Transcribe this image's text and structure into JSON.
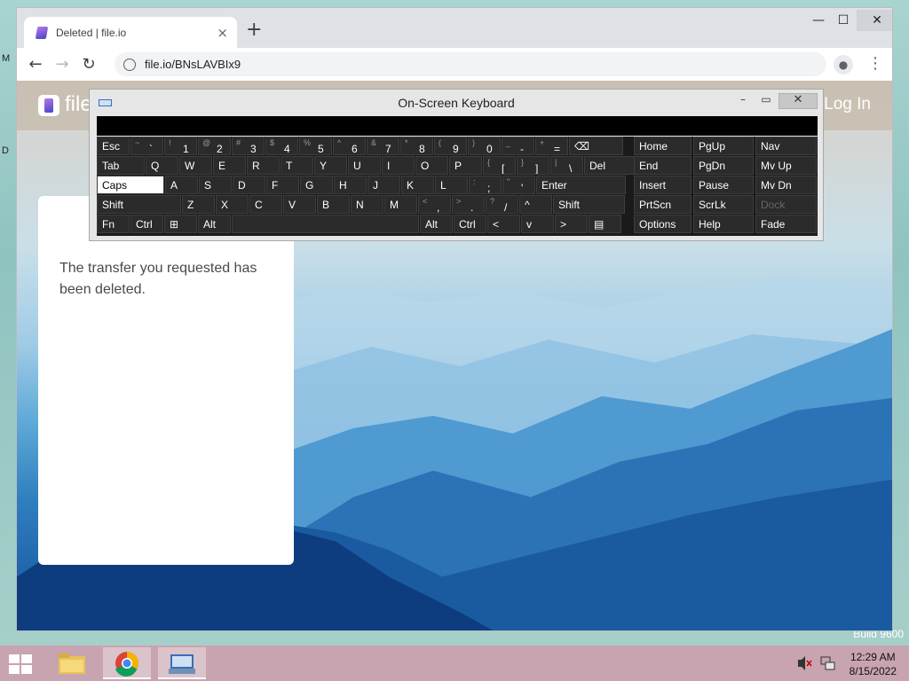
{
  "desktop": {
    "fragments": [
      "M",
      "D"
    ],
    "build_text": "Build 9600"
  },
  "browser": {
    "tab_title": "Deleted | file.io",
    "tab_close": "×",
    "new_tab": "+",
    "url": "file.io/BNsLAVBIx9",
    "window_controls": {
      "minimize": "—",
      "maximize": "☐",
      "close": "✕"
    },
    "nav": {
      "back": "←",
      "forward": "→",
      "reload": "↻",
      "menu": "⋮"
    }
  },
  "page": {
    "site_name": "file",
    "login": "Log In",
    "message": "The transfer you requested has been deleted."
  },
  "osk": {
    "title": "On-Screen Keyboard",
    "controls": {
      "minimize": "–",
      "maximize": "▭",
      "close": "✕"
    },
    "rows": [
      [
        {
          "m": "Esc"
        },
        {
          "s": "~",
          "p": "`"
        },
        {
          "s": "!",
          "p": "1"
        },
        {
          "s": "@",
          "p": "2"
        },
        {
          "s": "#",
          "p": "3"
        },
        {
          "s": "$",
          "p": "4"
        },
        {
          "s": "%",
          "p": "5"
        },
        {
          "s": "^",
          "p": "6"
        },
        {
          "s": "&",
          "p": "7"
        },
        {
          "s": "*",
          "p": "8"
        },
        {
          "s": "(",
          "p": "9"
        },
        {
          "s": ")",
          "p": "0"
        },
        {
          "s": "_",
          "p": "-"
        },
        {
          "s": "+",
          "p": "="
        },
        {
          "m": "⌫"
        }
      ],
      [
        {
          "m": "Tab"
        },
        {
          "m": "Q"
        },
        {
          "m": "W"
        },
        {
          "m": "E"
        },
        {
          "m": "R"
        },
        {
          "m": "T"
        },
        {
          "m": "Y"
        },
        {
          "m": "U"
        },
        {
          "m": "I"
        },
        {
          "m": "O"
        },
        {
          "m": "P"
        },
        {
          "s": "{",
          "p": "["
        },
        {
          "s": "}",
          "p": "]"
        },
        {
          "s": "|",
          "p": "\\"
        },
        {
          "m": "Del"
        }
      ],
      [
        {
          "m": "Caps"
        },
        {
          "m": "A"
        },
        {
          "m": "S"
        },
        {
          "m": "D"
        },
        {
          "m": "F"
        },
        {
          "m": "G"
        },
        {
          "m": "H"
        },
        {
          "m": "J"
        },
        {
          "m": "K"
        },
        {
          "m": "L"
        },
        {
          "s": ":",
          "p": ";"
        },
        {
          "s": "\"",
          "p": "'"
        },
        {
          "m": "Enter"
        }
      ],
      [
        {
          "m": "Shift"
        },
        {
          "m": "Z"
        },
        {
          "m": "X"
        },
        {
          "m": "C"
        },
        {
          "m": "V"
        },
        {
          "m": "B"
        },
        {
          "m": "N"
        },
        {
          "m": "M"
        },
        {
          "s": "<",
          "p": ","
        },
        {
          "s": ">",
          "p": "."
        },
        {
          "s": "?",
          "p": "/"
        },
        {
          "m": "^"
        },
        {
          "m": "Shift"
        }
      ],
      [
        {
          "m": "Fn"
        },
        {
          "m": "Ctrl"
        },
        {
          "m": "⊞"
        },
        {
          "m": "Alt"
        },
        {
          "m": ""
        },
        {
          "m": "Alt"
        },
        {
          "m": "Ctrl"
        },
        {
          "m": "<"
        },
        {
          "m": "v"
        },
        {
          "m": ">"
        },
        {
          "m": "▤"
        }
      ]
    ],
    "nav_keys": [
      [
        "Home",
        "PgUp",
        "Nav"
      ],
      [
        "End",
        "PgDn",
        "Mv Up"
      ],
      [
        "Insert",
        "Pause",
        "Mv Dn"
      ],
      [
        "PrtScn",
        "ScrLk",
        "Dock"
      ],
      [
        "Options",
        "Help",
        "Fade"
      ]
    ]
  },
  "taskbar": {
    "time": "12:29 AM",
    "date": "8/15/2022"
  }
}
